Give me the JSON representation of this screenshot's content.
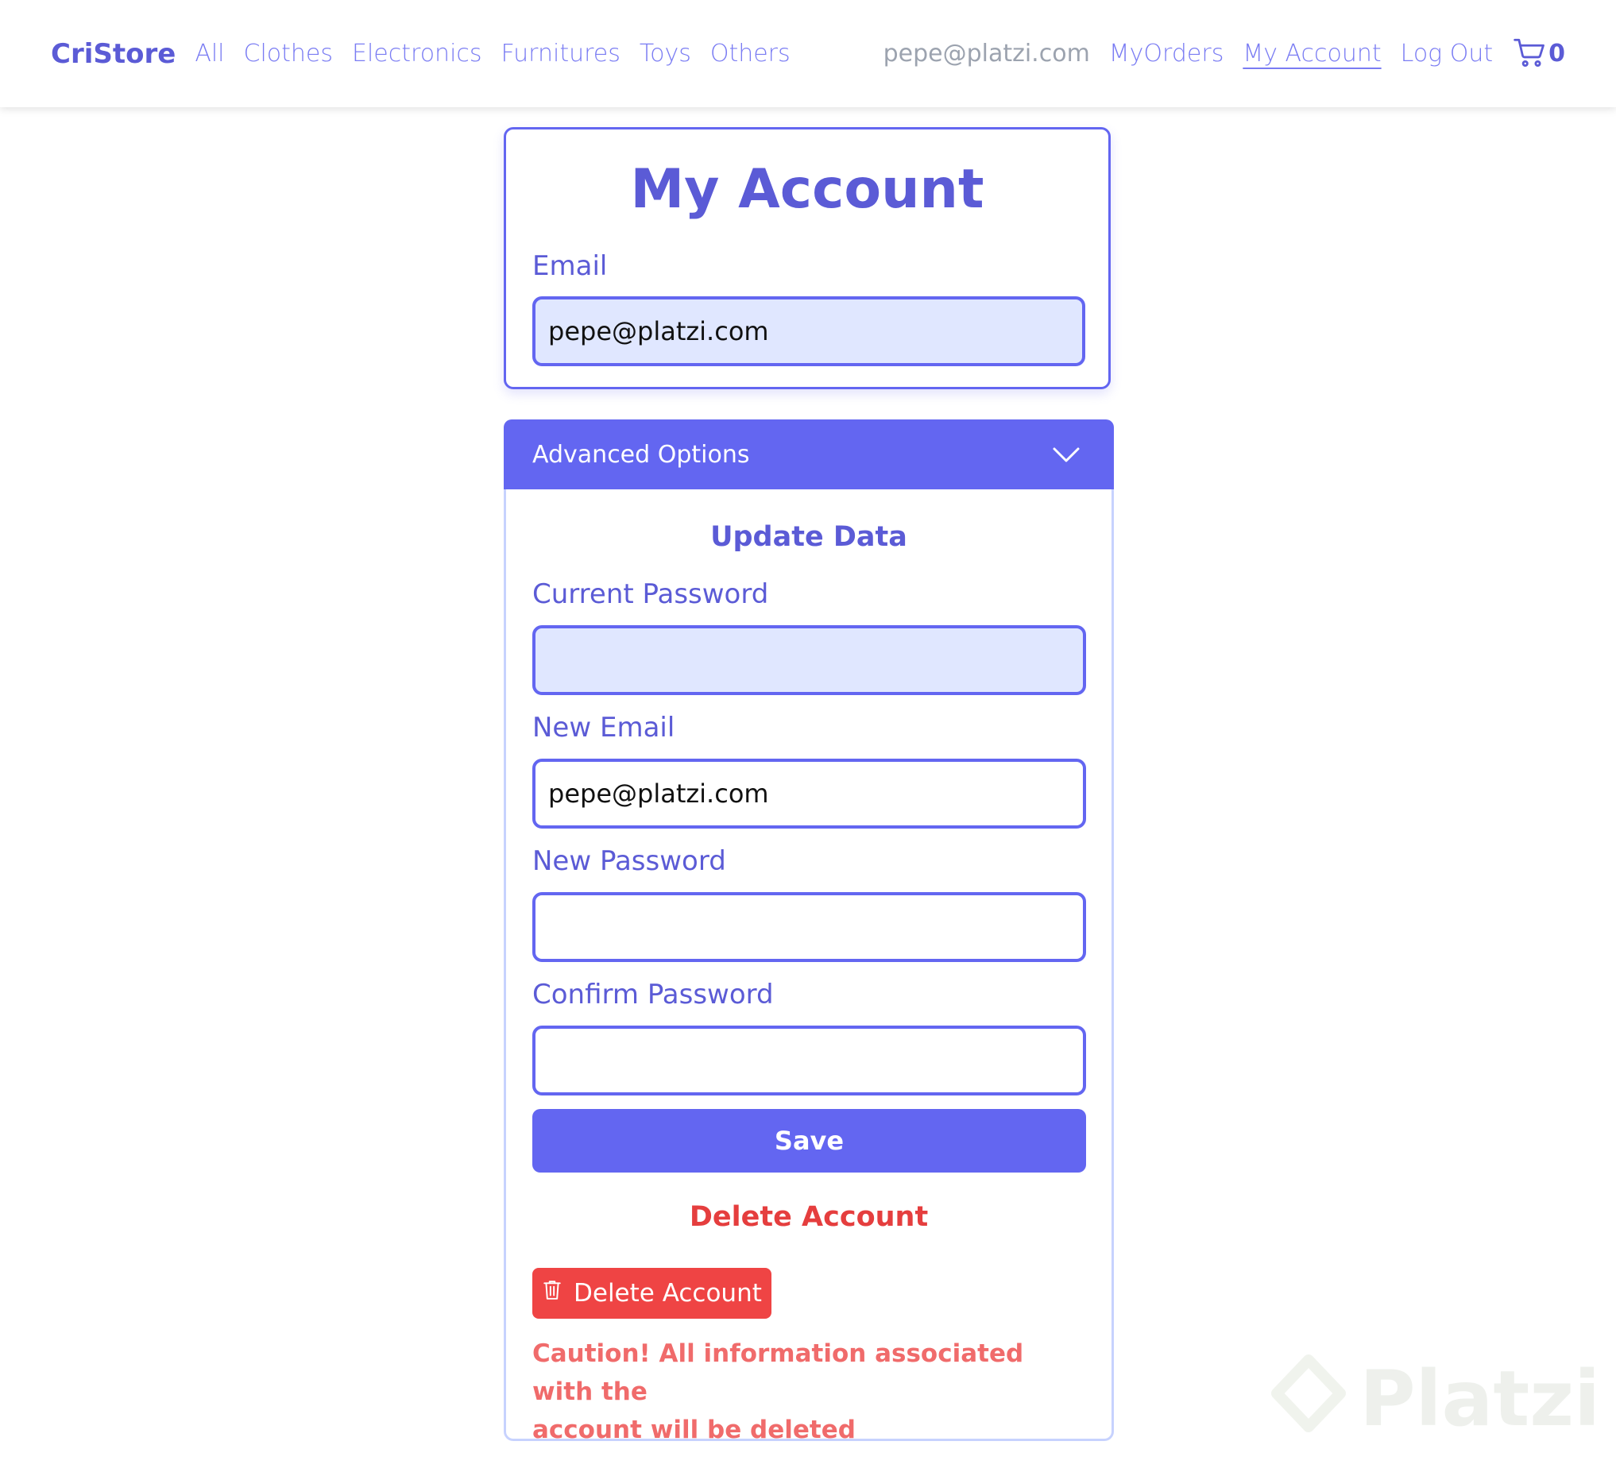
{
  "navbar": {
    "brand": "CriStore",
    "links": [
      "All",
      "Clothes",
      "Electronics",
      "Furnitures",
      "Toys",
      "Others"
    ],
    "user_email": "pepe@platzi.com",
    "my_orders": "MyOrders",
    "my_account": "My Account",
    "log_out": "Log Out",
    "cart_count": "0",
    "cart_icon": "shopping-cart-icon"
  },
  "account": {
    "title": "My Account",
    "email_label": "Email",
    "email_value": "pepe@platzi.com"
  },
  "advanced": {
    "header": "Advanced Options",
    "chevron_icon": "chevron-down-icon",
    "update_title": "Update Data",
    "current_password_label": "Current Password",
    "current_password_value": "",
    "new_email_label": "New Email",
    "new_email_value": "pepe@platzi.com",
    "new_password_label": "New Password",
    "new_password_value": "",
    "confirm_password_label": "Confirm Password",
    "confirm_password_value": "",
    "save_label": "Save",
    "delete_title": "Delete Account",
    "delete_button_label": "Delete Account",
    "delete_icon": "trash-icon",
    "caution_line1": "Caution! All information associated with the",
    "caution_line2": "account will be deleted"
  },
  "watermark": {
    "text": "Platzi"
  },
  "colors": {
    "primary": "#6366f1",
    "danger": "#ef4444",
    "input_fill": "#e0e7ff"
  }
}
